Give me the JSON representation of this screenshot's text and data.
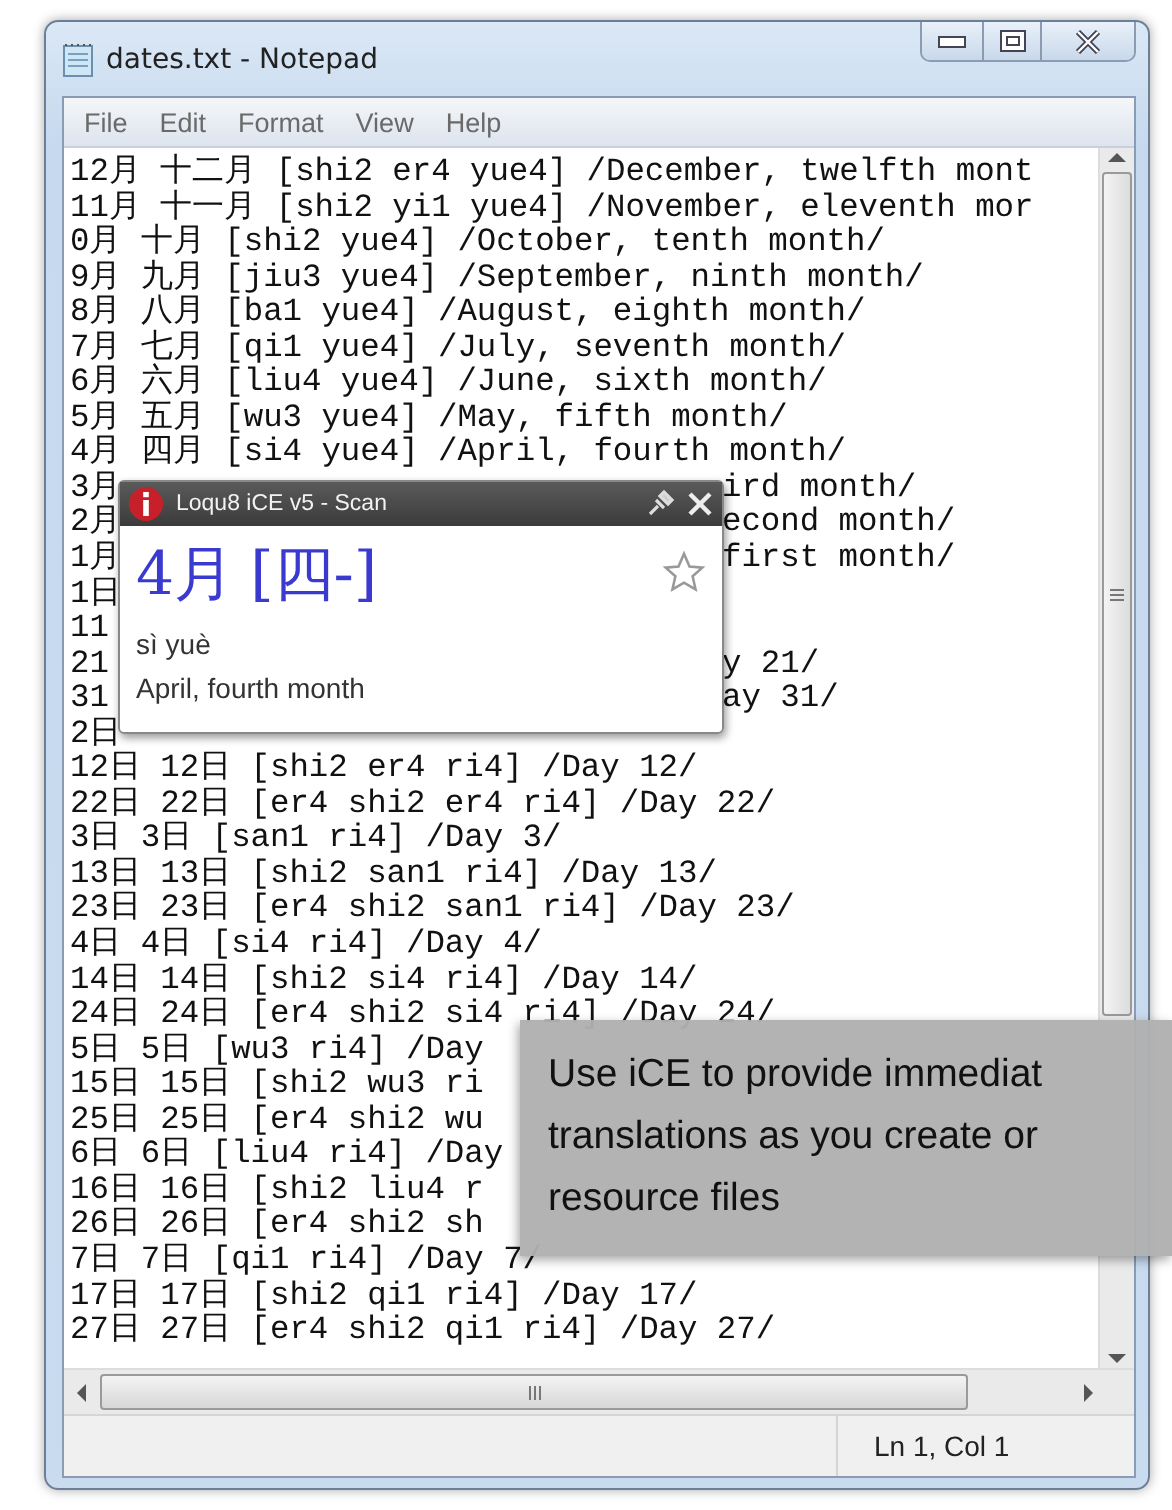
{
  "window": {
    "title": "dates.txt - Notepad"
  },
  "menu": [
    {
      "label": "File"
    },
    {
      "label": "Edit"
    },
    {
      "label": "Format"
    },
    {
      "label": "View"
    },
    {
      "label": "Help"
    }
  ],
  "lines": [
    {
      "text": "12月 十二月 [shi2 er4 yue4] /December, twelfth mont"
    },
    {
      "text": "11月 十一月 [shi2 yi1 yue4] /November, eleventh mor"
    },
    {
      "text": "0月 十月 [shi2 yue4] /October, tenth month/"
    },
    {
      "text": "9月 九月 [jiu3 yue4] /September, ninth month/"
    },
    {
      "text": "8月 八月 [ba1 yue4] /August, eighth month/"
    },
    {
      "text": "7月 七月 [qi1 yue4] /July, seventh month/"
    },
    {
      "text": "6月 六月 [liu4 yue4] /June, sixth month/"
    },
    {
      "text": "5月 五月 [wu3 yue4] /May, fifth month/"
    },
    {
      "text": "4月 四月 [si4 yue4] /April, fourth month/"
    },
    {
      "text": "3月",
      "tail": "ird month/"
    },
    {
      "text": "2月",
      "tail": "econd month/"
    },
    {
      "text": "1月",
      "tail": "first month/"
    },
    {
      "text": "1日"
    },
    {
      "text": "11"
    },
    {
      "text": "21",
      "tail": "y 21/"
    },
    {
      "text": "31",
      "tail": "ay 31/"
    },
    {
      "text": "2日"
    },
    {
      "text": "12日 12日 [shi2 er4 ri4] /Day 12/"
    },
    {
      "text": "22日 22日 [er4 shi2 er4 ri4] /Day 22/"
    },
    {
      "text": "3日 3日 [san1 ri4] /Day 3/"
    },
    {
      "text": "13日 13日 [shi2 san1 ri4] /Day 13/"
    },
    {
      "text": "23日 23日 [er4 shi2 san1 ri4] /Day 23/"
    },
    {
      "text": "4日 4日 [si4 ri4] /Day 4/"
    },
    {
      "text": "14日 14日 [shi2 si4 ri4] /Day 14/"
    },
    {
      "text": "24日 24日 [er4 shi2 si4 ri4] /Day 24/"
    },
    {
      "text": "5日 5日 [wu3 ri4] /Day"
    },
    {
      "text": "15日 15日 [shi2 wu3 ri"
    },
    {
      "text": "25日 25日 [er4 shi2 wu"
    },
    {
      "text": "6日 6日 [liu4 ri4] /Day"
    },
    {
      "text": "16日 16日 [shi2 liu4 r"
    },
    {
      "text": "26日 26日 [er4 shi2 sh"
    },
    {
      "text": "7日 7日 [qi1 ri4] /Day 7/"
    },
    {
      "text": "17日 17日 [shi2 qi1 ri4] /Day 17/"
    },
    {
      "text": "27日 27日 [er4 shi2 qi1 ri4] /Day 27/"
    }
  ],
  "popup": {
    "title": "Loqu8 iCE v5 - Scan",
    "headword": "4月",
    "variant": "[四-]",
    "reading": "sì yuè",
    "definition": "April, fourth month"
  },
  "callout": {
    "lines": [
      "Use iCE to provide immediat",
      "translations as you create or",
      "resource files"
    ]
  },
  "status_bar": {
    "position": "Ln 1, Col 1"
  }
}
